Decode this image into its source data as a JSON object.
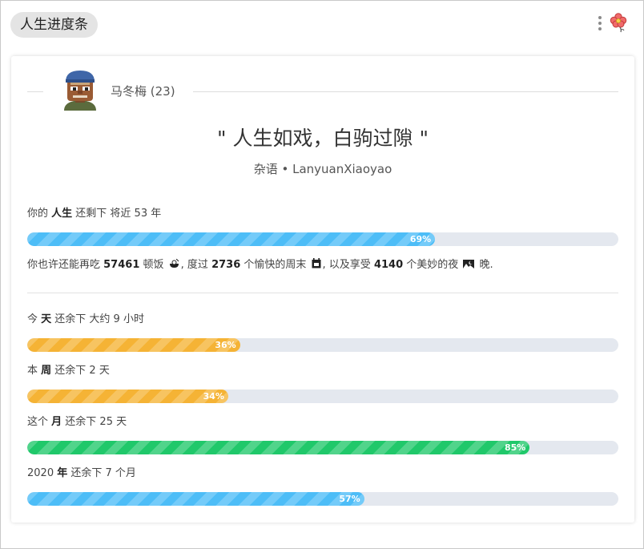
{
  "header": {
    "title": "人生进度条"
  },
  "user": {
    "name": "马冬梅 (23)"
  },
  "quote": {
    "text": "\" 人生如戏，白驹过隙 \"",
    "source": "杂语 • LanyuanXiaoyao"
  },
  "life": {
    "prefix": "你的 ",
    "bold": "人生",
    "suffix": " 还剩下 将近 53 年",
    "percent_label": "69%",
    "progress": 69,
    "color": "#4dbdf7"
  },
  "stats": {
    "t1": "你也许还能再吃 ",
    "meals": "57461",
    "t2": " 顿饭",
    "t3": ", 度过 ",
    "weekends": "2736",
    "t4": " 个愉快的周末",
    "t5": ", 以及享受 ",
    "nights": "4140",
    "t6": " 个美妙的夜",
    "t7": " 晚."
  },
  "bars": [
    {
      "prefix": "今 ",
      "bold": "天",
      "suffix": " 还余下 大约 9 小时",
      "percent_label": "36%",
      "progress": 36,
      "color": "#f5b335"
    },
    {
      "prefix": "本 ",
      "bold": "周",
      "suffix": " 还余下 2 天",
      "percent_label": "34%",
      "progress": 34,
      "color": "#f5b335"
    },
    {
      "prefix": "这个 ",
      "bold": "月",
      "suffix": " 还余下 25 天",
      "percent_label": "85%",
      "progress": 85,
      "color": "#20c86a"
    },
    {
      "prefix": "2020 ",
      "bold": "年",
      "suffix": " 还余下 7 个月",
      "percent_label": "57%",
      "progress": 57,
      "color": "#4dbdf7"
    }
  ],
  "icons": {
    "menu": "more-vertical-icon",
    "flower": "flower-icon",
    "meal": "rice-bowl-icon",
    "weekend": "calendar-icon",
    "night": "moon-night-icon"
  }
}
